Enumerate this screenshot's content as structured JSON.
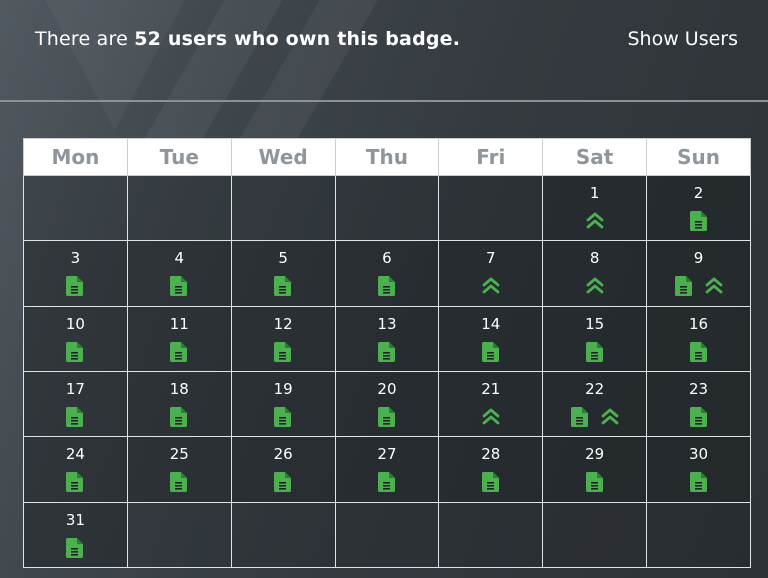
{
  "header": {
    "prefix": "There are ",
    "count_text": "52 users who own this badge.",
    "show_users": "Show Users"
  },
  "colors": {
    "icon_green": "#4caf50",
    "header_bg": "#ffffff",
    "header_text": "#8e969c"
  },
  "calendar": {
    "weekdays": [
      "Mon",
      "Tue",
      "Wed",
      "Thu",
      "Fri",
      "Sat",
      "Sun"
    ],
    "weeks": [
      [
        {
          "day": "",
          "icons": []
        },
        {
          "day": "",
          "icons": []
        },
        {
          "day": "",
          "icons": []
        },
        {
          "day": "",
          "icons": []
        },
        {
          "day": "",
          "icons": []
        },
        {
          "day": "1",
          "icons": [
            "chevron-up-double-icon"
          ]
        },
        {
          "day": "2",
          "icons": [
            "document-icon"
          ]
        }
      ],
      [
        {
          "day": "3",
          "icons": [
            "document-icon"
          ]
        },
        {
          "day": "4",
          "icons": [
            "document-icon"
          ]
        },
        {
          "day": "5",
          "icons": [
            "document-icon"
          ]
        },
        {
          "day": "6",
          "icons": [
            "document-icon"
          ]
        },
        {
          "day": "7",
          "icons": [
            "chevron-up-double-icon"
          ]
        },
        {
          "day": "8",
          "icons": [
            "chevron-up-double-icon"
          ]
        },
        {
          "day": "9",
          "icons": [
            "document-icon",
            "chevron-up-double-icon"
          ]
        }
      ],
      [
        {
          "day": "10",
          "icons": [
            "document-icon"
          ]
        },
        {
          "day": "11",
          "icons": [
            "document-icon"
          ]
        },
        {
          "day": "12",
          "icons": [
            "document-icon"
          ]
        },
        {
          "day": "13",
          "icons": [
            "document-icon"
          ]
        },
        {
          "day": "14",
          "icons": [
            "document-icon"
          ]
        },
        {
          "day": "15",
          "icons": [
            "document-icon"
          ]
        },
        {
          "day": "16",
          "icons": [
            "document-icon"
          ]
        }
      ],
      [
        {
          "day": "17",
          "icons": [
            "document-icon"
          ]
        },
        {
          "day": "18",
          "icons": [
            "document-icon"
          ]
        },
        {
          "day": "19",
          "icons": [
            "document-icon"
          ]
        },
        {
          "day": "20",
          "icons": [
            "document-icon"
          ]
        },
        {
          "day": "21",
          "icons": [
            "chevron-up-double-icon"
          ]
        },
        {
          "day": "22",
          "icons": [
            "document-icon",
            "chevron-up-double-icon"
          ]
        },
        {
          "day": "23",
          "icons": [
            "document-icon"
          ]
        }
      ],
      [
        {
          "day": "24",
          "icons": [
            "document-icon"
          ]
        },
        {
          "day": "25",
          "icons": [
            "document-icon"
          ]
        },
        {
          "day": "26",
          "icons": [
            "document-icon"
          ]
        },
        {
          "day": "27",
          "icons": [
            "document-icon"
          ]
        },
        {
          "day": "28",
          "icons": [
            "document-icon"
          ]
        },
        {
          "day": "29",
          "icons": [
            "document-icon"
          ]
        },
        {
          "day": "30",
          "icons": [
            "document-icon"
          ]
        }
      ],
      [
        {
          "day": "31",
          "icons": [
            "document-icon"
          ]
        },
        {
          "day": "",
          "icons": []
        },
        {
          "day": "",
          "icons": []
        },
        {
          "day": "",
          "icons": []
        },
        {
          "day": "",
          "icons": []
        },
        {
          "day": "",
          "icons": []
        },
        {
          "day": "",
          "icons": []
        }
      ]
    ]
  }
}
